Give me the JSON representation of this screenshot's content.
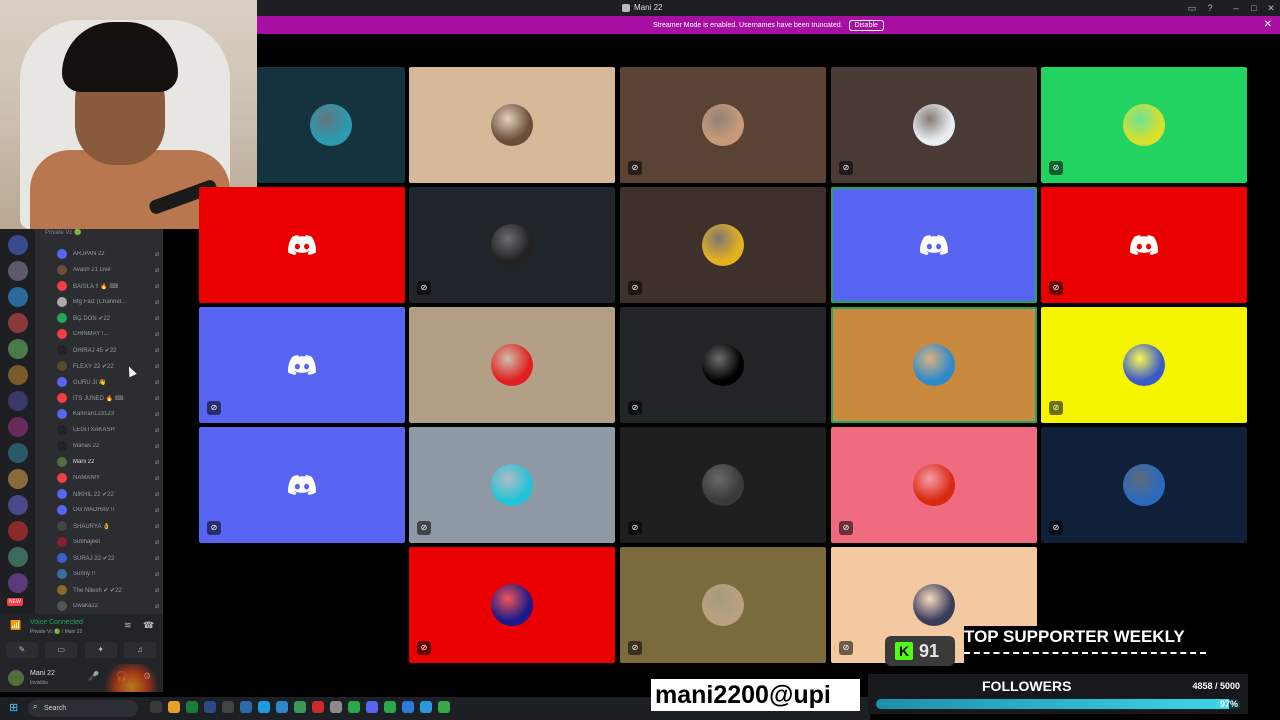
{
  "window": {
    "title": "Mani 22"
  },
  "banner": {
    "text": "Streamer Mode is enabled. Usernames have been truncated.",
    "button": "Disable"
  },
  "channel": {
    "header": "Private Vc 🟢"
  },
  "members": [
    {
      "name": "ARJPAN 22",
      "color": "#5865f2"
    },
    {
      "name": "Avash 21 Live",
      "color": "#6b4f3a"
    },
    {
      "name": "BAISLA !! 🔥 ⌨",
      "color": "#f23f43"
    },
    {
      "name": "Bfg Faiz (Channel...",
      "color": "#aaaaaa"
    },
    {
      "name": "BĢ DON ✔22",
      "color": "#23a55a"
    },
    {
      "name": "CHINMAY !...",
      "color": "#f23f43"
    },
    {
      "name": "DHIRAJ 45 ✔22",
      "color": "#202225"
    },
    {
      "name": "FLEXY 22 ✔22",
      "color": "#5a4a2a"
    },
    {
      "name": "GURU JI 👋",
      "color": "#5865f2"
    },
    {
      "name": "ITS JUNED 🔥 ⌨",
      "color": "#f23f43"
    },
    {
      "name": "Kamran123123",
      "color": "#5865f2"
    },
    {
      "name": "LEGITXAKASH",
      "color": "#202225"
    },
    {
      "name": "Manas 22",
      "color": "#202225"
    },
    {
      "name": "Mani 22",
      "color": "#4f6f3f"
    },
    {
      "name": "NAMAN!!!",
      "color": "#f23f43"
    },
    {
      "name": "NIKHIL 22 ✔22",
      "color": "#5865f2"
    },
    {
      "name": "OG MADHAV !!",
      "color": "#5865f2"
    },
    {
      "name": "SHAURYA 👌",
      "color": "#444444"
    },
    {
      "name": "Subhajeet",
      "color": "#8b1e2b"
    },
    {
      "name": "SURAJ 22 ✔22",
      "color": "#3a5fcd"
    },
    {
      "name": "Sunny !!",
      "color": "#3a6fa0"
    },
    {
      "name": "The Nilesh ✔ ✔22",
      "color": "#8a6a2a"
    },
    {
      "name": "Dwaka22",
      "color": "#555555"
    }
  ],
  "voice": {
    "status": "Voice Connected",
    "channel": "Private Vc 🟢 / Mani 22"
  },
  "user": {
    "name": "Mani 22",
    "status": "Invisible"
  },
  "taskbar": {
    "search_placeholder": "Search"
  },
  "tiles": [
    {
      "bg": "#15323f",
      "pic": "#2a9bb0",
      "muted": false
    },
    {
      "bg": "#d7b99a",
      "pic": "#6a4e3a",
      "muted": false
    },
    {
      "bg": "#5a4334",
      "pic": "#c99a7a",
      "muted": true
    },
    {
      "bg": "#4a3a35",
      "pic": "#e8eef2",
      "muted": true
    },
    {
      "bg": "#22d362",
      "pic": "#d8e02a",
      "muted": true
    },
    {
      "bg": "#ea0000",
      "discord": true,
      "muted": false
    },
    {
      "bg": "#1f252b",
      "pic": "#222222",
      "muted": true
    },
    {
      "bg": "#3e312c",
      "pic": "#e4b21f",
      "muted": true
    },
    {
      "bg": "#5864f2",
      "discord": true,
      "muted": false,
      "speaking": true
    },
    {
      "bg": "#ea0000",
      "discord": true,
      "muted": true
    },
    {
      "bg": "#5865f2",
      "discord": true,
      "muted": true
    },
    {
      "bg": "#b39f85",
      "pic": "#e02020",
      "muted": false
    },
    {
      "bg": "#212526",
      "pic": "#000000",
      "muted": true
    },
    {
      "bg": "#c9893f",
      "pic": "#2f8acb",
      "muted": false,
      "speaking": true
    },
    {
      "bg": "#f5f500",
      "pic": "#3a5ac8",
      "muted": true
    },
    {
      "bg": "#5865f2",
      "discord": true,
      "muted": true
    },
    {
      "bg": "#8f99a6",
      "pic": "#22c3d8",
      "muted": true
    },
    {
      "bg": "#1e1e1e",
      "pic": "#3a3a3a",
      "muted": true
    },
    {
      "bg": "#f06a80",
      "pic": "#d82a10",
      "muted": true
    },
    {
      "bg": "#0f2038",
      "pic": "#2a6ac0",
      "muted": true
    },
    {
      "bg": "#ea0000",
      "pic": "#1a1a8a",
      "muted": true
    },
    {
      "bg": "#7a6a3c",
      "pic": "#b8a080",
      "muted": true
    },
    {
      "bg": "#f2c9a0",
      "pic": "#3a3a5a",
      "muted": true
    }
  ],
  "overlays": {
    "upi": "mani2200@upi",
    "kick_count": "91",
    "supporter_title": "TOP SUPPORTER WEEKLY",
    "followers_label": "FOLLOWERS",
    "followers_count": "4858 / 5000",
    "followers_pct": "97%",
    "followers_fraction": 0.97
  }
}
